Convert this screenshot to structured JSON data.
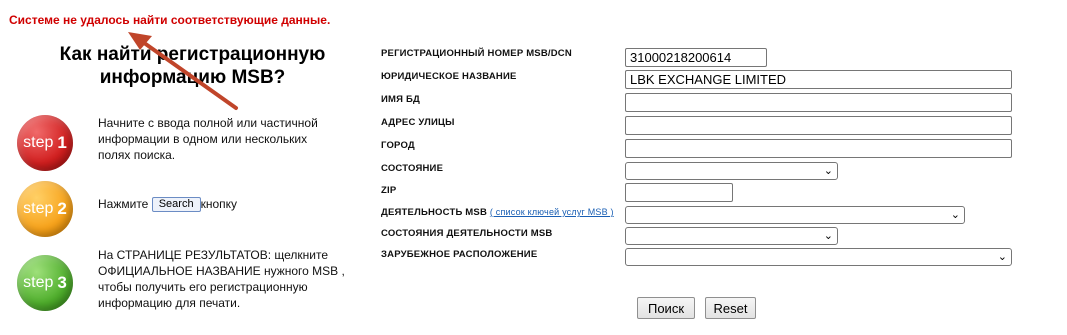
{
  "error_message": "Системе не удалось найти соответствующие данные.",
  "howto_title": "Как найти регистрационную информацию MSB?",
  "steps": [
    {
      "badge_word": "step",
      "badge_num": "1",
      "text": "Начните с ввода полной или частичной информации в одном или нескольких полях поиска."
    },
    {
      "badge_word": "step",
      "badge_num": "2",
      "text_before": "Нажмите",
      "button_label": "Search",
      "text_after": "кнопку"
    },
    {
      "badge_word": "step",
      "badge_num": "3",
      "text": "На СТРАНИЦЕ РЕЗУЛЬТАТОВ: щелкните ОФИЦИАЛЬНОЕ НАЗВАНИЕ нужного MSB , чтобы получить его регистрационную информацию для печати."
    }
  ],
  "form": {
    "msb_number_label": "РЕГИСТРАЦИОННЫЙ НОМЕР MSB/DCN",
    "msb_number_value": "31000218200614",
    "legal_name_label": "ЮРИДИЧЕСКОЕ НАЗВАНИЕ",
    "legal_name_value": "LBK EXCHANGE LIMITED",
    "dba_label": "ИМЯ БД",
    "street_label": "АДРЕС УЛИЦЫ",
    "city_label": "ГОРОД",
    "state_label": "СОСТОЯНИЕ",
    "zip_label": "ZIP",
    "activity_label": "ДЕЯТЕЛЬНОСТЬ MSB",
    "activity_link": "( список ключей услуг MSB )",
    "activity_states_label": "СОСТОЯНИЯ ДЕЯТЕЛЬНОСТИ MSB",
    "foreign_label": "ЗАРУБЕЖНОЕ РАСПОЛОЖЕНИЕ",
    "search_button": "Поиск",
    "reset_button": "Reset"
  },
  "colors": {
    "error": "#d00000",
    "arrow": "#c0452a",
    "link": "#1a5fb4"
  },
  "icons": {
    "dropdown": "chevron-down-icon"
  }
}
